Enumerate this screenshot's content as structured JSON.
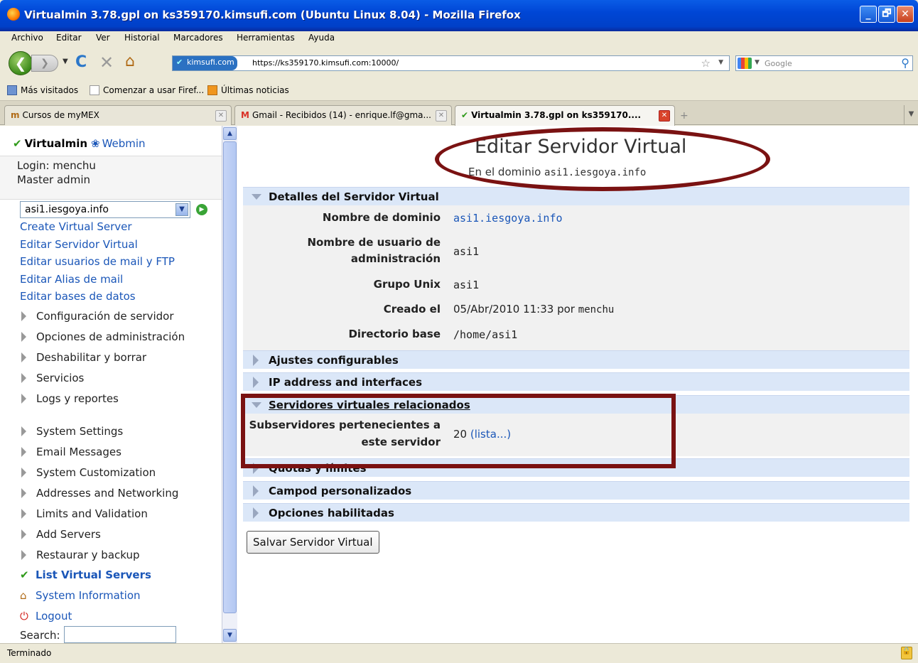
{
  "window": {
    "title": "Virtualmin 3.78.gpl on ks359170.kimsufi.com (Ubuntu Linux 8.04) - Mozilla Firefox",
    "minimize": "_",
    "maximize": "🗗",
    "close": "✕"
  },
  "menu": [
    "Archivo",
    "Editar",
    "Ver",
    "Historial",
    "Marcadores",
    "Herramientas",
    "Ayuda"
  ],
  "nav": {
    "site_identity": "kimsufi.com",
    "url": "https://ks359170.kimsufi.com:10000/",
    "search_placeholder": "Google"
  },
  "bookmarks": [
    "Más visitados",
    "Comenzar a usar Firef...",
    "Últimas noticias"
  ],
  "tabs": [
    {
      "label": "Cursos de myMEX"
    },
    {
      "label": "Gmail - Recibidos (14) - enrique.lf@gma..."
    },
    {
      "label": "Virtualmin 3.78.gpl on ks359170...."
    }
  ],
  "sidebar": {
    "virtualmin": "Virtualmin",
    "webmin": "Webmin",
    "login": "Login: menchu",
    "role": "Master admin",
    "domain_select": "asi1.iesgoya.info",
    "links": [
      "Create Virtual Server",
      "Editar Servidor Virtual",
      "Editar usuarios de mail y FTP",
      "Editar Alias de mail",
      "Editar bases de datos"
    ],
    "categories": [
      "Configuración de servidor",
      "Opciones de administración",
      "Deshabilitar y borrar",
      "Servicios",
      "Logs y reportes"
    ],
    "system_categories": [
      "System Settings",
      "Email Messages",
      "System Customization",
      "Addresses and Networking",
      "Limits and Validation",
      "Add Servers",
      "Restaurar y backup"
    ],
    "list_servers": "List Virtual Servers",
    "system_info": "System Information",
    "logout": "Logout",
    "search_label": "Search:"
  },
  "main": {
    "title": "Editar Servidor Virtual",
    "subtitle_prefix": "En el dominio",
    "subtitle_domain": "asi1.iesgoya.info",
    "details_header": "Detalles del Servidor Virtual",
    "fields": {
      "domain_label": "Nombre de dominio",
      "domain_value": "asi1.iesgoya.info",
      "admin_user_label_1": "Nombre de usuario de",
      "admin_user_label_2": "administración",
      "admin_user_value": "asi1",
      "unix_group_label": "Grupo Unix",
      "unix_group_value": "asi1",
      "created_label": "Creado el",
      "created_value": "05/Abr/2010 11:33",
      "created_by_prefix": "por",
      "created_by": "menchu",
      "home_label": "Directorio base",
      "home_value": "/home/asi1"
    },
    "sections": {
      "configurable": "Ajustes configurables",
      "ip": "IP address and interfaces",
      "related": "Servidores virtuales relacionados",
      "quotas": "Quotas y límites",
      "custom": "Campod personalizados",
      "features": "Opciones habilitadas"
    },
    "related": {
      "label_1": "Subservidores pertenecientes a",
      "label_2": "este servidor",
      "count": "20",
      "list_link": "(lista...)"
    },
    "save_button": "Salvar Servidor Virtual"
  },
  "status": "Terminado",
  "colors": {
    "accent": "#1a56b8",
    "section_header": "#dbe7f8",
    "annotation": "#7a1212"
  }
}
